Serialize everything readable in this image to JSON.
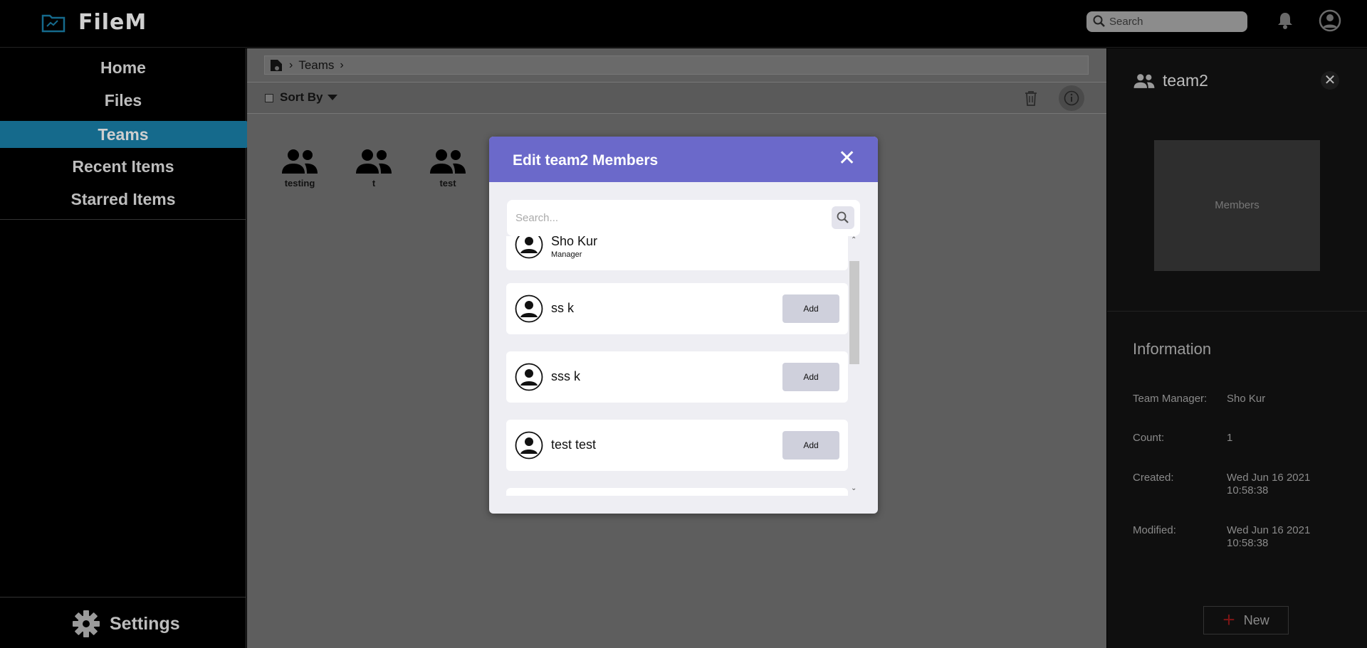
{
  "app": {
    "name": "FileM"
  },
  "topbar": {
    "search_placeholder": "Search"
  },
  "sidebar": {
    "items": [
      {
        "label": "Home"
      },
      {
        "label": "Files"
      },
      {
        "label": "Teams",
        "active": true
      },
      {
        "label": "Recent Items"
      },
      {
        "label": "Starred Items"
      }
    ],
    "settings_label": "Settings"
  },
  "breadcrumb": {
    "items": [
      "Teams"
    ]
  },
  "toolbar": {
    "sort_label": "Sort By"
  },
  "teams": [
    {
      "name": "testing"
    },
    {
      "name": "t"
    },
    {
      "name": "test"
    }
  ],
  "right_panel": {
    "title": "team2",
    "members_label": "Members",
    "info_title": "Information",
    "fields": [
      {
        "label": "Team Manager:",
        "value": "Sho Kur"
      },
      {
        "label": "Count:",
        "value": "1"
      },
      {
        "label": "Created:",
        "value": "Wed Jun 16 2021 10:58:38"
      },
      {
        "label": "Modified:",
        "value": "Wed Jun 16 2021 10:58:38"
      }
    ],
    "new_label": "New"
  },
  "modal": {
    "title": "Edit team2 Members",
    "search_placeholder": "Search...",
    "members": [
      {
        "name": "Sho Kur",
        "role": "Manager"
      },
      {
        "name": "ss k",
        "action": "Add"
      },
      {
        "name": "sss k",
        "action": "Add"
      },
      {
        "name": "test test",
        "action": "Add"
      }
    ]
  },
  "colors": {
    "accent": "#156a8c",
    "modal_header": "#6b69ca",
    "new_plus": "#7a1515"
  }
}
